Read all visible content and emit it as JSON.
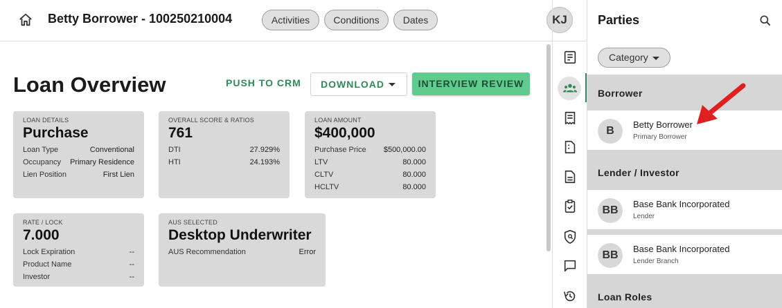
{
  "header": {
    "title": "Betty Borrower - 100250210004",
    "tabs": [
      "Activities",
      "Conditions",
      "Dates"
    ],
    "user_initials": "KJ"
  },
  "main": {
    "title": "Loan Overview",
    "push_label": "PUSH TO CRM",
    "download_label": "DOWNLOAD",
    "interview_label": "INTERVIEW REVIEW",
    "cards": [
      {
        "label": "LOAN DETAILS",
        "value": "Purchase",
        "rows": [
          {
            "k": "Loan Type",
            "v": "Conventional"
          },
          {
            "k": "Occupancy",
            "v": "Primary Residence"
          },
          {
            "k": "Lien Position",
            "v": "First Lien"
          }
        ]
      },
      {
        "label": "OVERALL SCORE & RATIOS",
        "value": "761",
        "rows": [
          {
            "k": "DTI",
            "v": "27.929%"
          },
          {
            "k": "HTI",
            "v": "24.193%"
          }
        ]
      },
      {
        "label": "LOAN AMOUNT",
        "value": "$400,000",
        "rows": [
          {
            "k": "Purchase Price",
            "v": "$500,000.00"
          },
          {
            "k": "LTV",
            "v": "80.000"
          },
          {
            "k": "CLTV",
            "v": "80.000"
          },
          {
            "k": "HCLTV",
            "v": "80.000"
          }
        ]
      },
      {
        "label": "RATE / LOCK",
        "value": "7.000",
        "rows": [
          {
            "k": "Lock Expiration",
            "v": "--"
          },
          {
            "k": "Product Name",
            "v": "--"
          },
          {
            "k": "Investor",
            "v": "--"
          }
        ]
      },
      {
        "label": "AUS SELECTED",
        "value": "Desktop Underwriter",
        "rows": [
          {
            "k": "AUS Recommendation",
            "v": "Error"
          }
        ]
      }
    ]
  },
  "parties": {
    "title": "Parties",
    "category_label": "Category",
    "sections": [
      {
        "heading": "Borrower",
        "items": [
          {
            "initials": "B",
            "name": "Betty Borrower",
            "role": "Primary Borrower"
          }
        ]
      },
      {
        "heading": "Lender / Investor",
        "items": [
          {
            "initials": "BB",
            "name": "Base Bank Incorporated",
            "role": "Lender"
          },
          {
            "initials": "BB",
            "name": "Base Bank Incorporated",
            "role": "Lender Branch"
          }
        ]
      },
      {
        "heading": "Loan Roles",
        "items": []
      }
    ]
  },
  "rail_icons": [
    "summary-icon",
    "parties-icon",
    "receipt-icon",
    "documents-icon",
    "file-icon",
    "checklist-icon",
    "security-icon",
    "chat-icon",
    "history-icon"
  ],
  "colors": {
    "accent": "#2e8b57",
    "primary_button": "#5fcb8f",
    "card_bg": "#d9d9d9",
    "annotation_arrow": "#e02020"
  }
}
